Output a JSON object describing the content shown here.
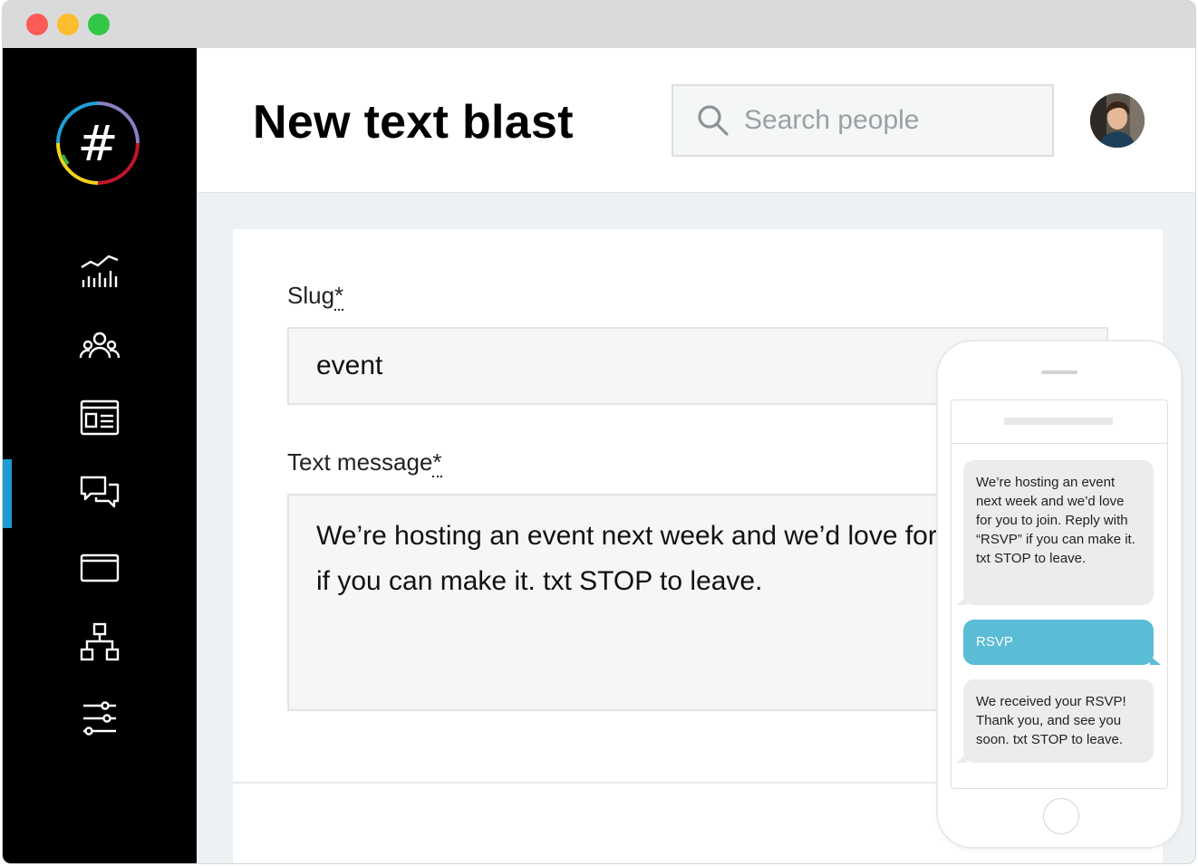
{
  "window": {
    "controls": [
      "close",
      "minimize",
      "maximize"
    ]
  },
  "sidebar": {
    "logo_text": "#",
    "items": [
      {
        "name": "analytics",
        "icon": "chart-icon"
      },
      {
        "name": "people",
        "icon": "people-icon"
      },
      {
        "name": "newsletter",
        "icon": "newspaper-icon"
      },
      {
        "name": "text-messages",
        "icon": "chat-icon",
        "active": true
      },
      {
        "name": "pages",
        "icon": "browser-window-icon"
      },
      {
        "name": "network",
        "icon": "hierarchy-icon"
      },
      {
        "name": "settings",
        "icon": "sliders-icon"
      }
    ],
    "active_color": "#1d9ad2"
  },
  "header": {
    "title": "New text blast",
    "search_placeholder": "Search people"
  },
  "form": {
    "slug_label": "Slug",
    "required_mark": "*",
    "slug_value": "event",
    "message_label": "Text message",
    "message_value": "We’re hosting an event next week and we’d love for you to join. Reply with “RSVP” if you can make it. txt STOP to leave."
  },
  "phone_preview": {
    "messages": [
      {
        "direction": "in",
        "text": "We’re hosting an event next week and we’d love for you  to join. Reply with “RSVP” if you can make it. txt STOP to leave."
      },
      {
        "direction": "out",
        "text": "RSVP"
      },
      {
        "direction": "in",
        "text": "We received your RSVP! Thank you, and see you soon. txt STOP to leave."
      }
    ],
    "reply_color": "#5bbcd6"
  }
}
